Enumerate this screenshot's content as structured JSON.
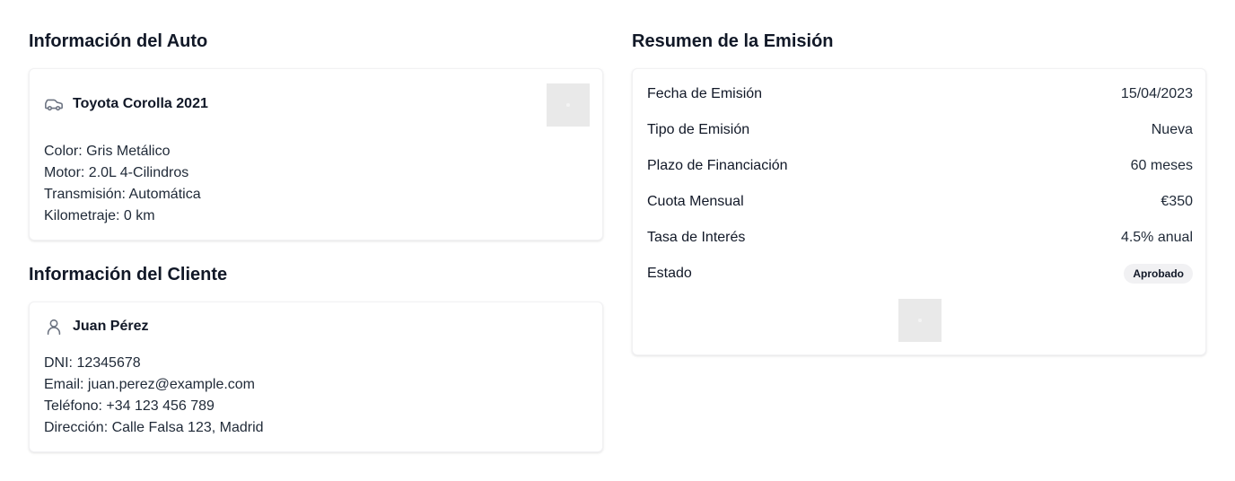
{
  "auto": {
    "section_title": "Información del Auto",
    "name": "Toyota Corolla 2021",
    "icon": "car-icon",
    "details": [
      "Color: Gris Metálico",
      "Motor: 2.0L 4-Cilindros",
      "Transmisión: Automática",
      "Kilometraje: 0 km"
    ]
  },
  "cliente": {
    "section_title": "Información del Cliente",
    "name": "Juan Pérez",
    "icon": "user-icon",
    "details": [
      "DNI: 12345678",
      "Email: juan.perez@example.com",
      "Teléfono: +34 123 456 789",
      "Dirección: Calle Falsa 123, Madrid"
    ]
  },
  "resumen": {
    "section_title": "Resumen de la Emisión",
    "rows": [
      {
        "label": "Fecha de Emisión",
        "value": "15/04/2023"
      },
      {
        "label": "Tipo de Emisión",
        "value": "Nueva"
      },
      {
        "label": "Plazo de Financiación",
        "value": "60 meses"
      },
      {
        "label": "Cuota Mensual",
        "value": "€350"
      },
      {
        "label": "Tasa de Interés",
        "value": "4.5% anual"
      },
      {
        "label": "Estado",
        "value": "Aprobado"
      }
    ]
  },
  "colors": {
    "text": "#111827",
    "card_border": "#f1f1f3",
    "badge_bg": "#f1f1f3",
    "placeholder": "#e9e9e9",
    "icon": "#6b7280"
  }
}
